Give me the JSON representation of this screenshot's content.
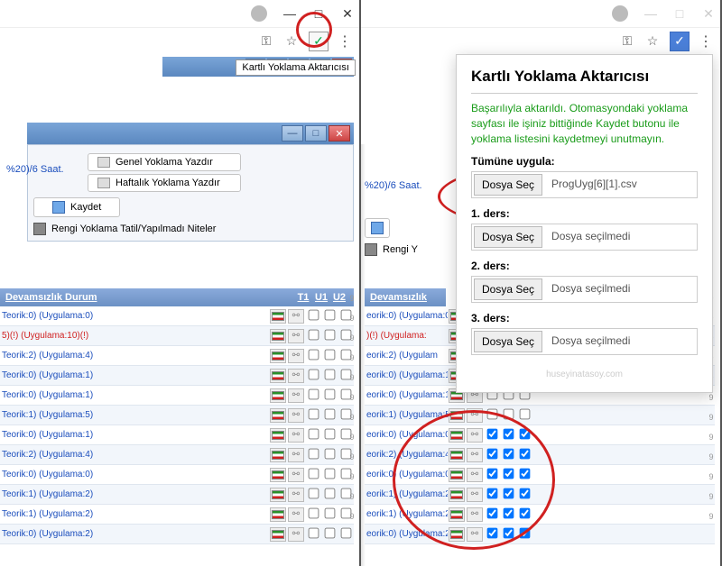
{
  "tooltip": "Kartlı Yoklama Aktarıcısı",
  "popup": {
    "title": "Kartlı Yoklama Aktarıcısı",
    "success": "Başarılıyla aktarıldı. Otomasyondaki yoklama sayfası ile işiniz bittiğinde Kaydet butonu ile yoklama listesini kaydetmeyi unutmayın.",
    "apply_all_label": "Tümüne uygula:",
    "btn_choose": "Dosya Seç",
    "file_all": "ProgUyg[6][1].csv",
    "file_none": "Dosya seçilmedi",
    "ders1": "1. ders:",
    "ders2": "2. ders:",
    "ders3": "3. ders:",
    "credit": "huseyinatasoy.com"
  },
  "panel": {
    "print_genel": "Genel Yoklama Yazdır",
    "print_haftalik": "Haftalık Yoklama Yazdır",
    "teorik_frag": "%20)/6 Saat.",
    "save": "Kaydet",
    "color_label": "Rengi Yoklama Tatil/Yapılmadı Niteler"
  },
  "table": {
    "hdr_durum": "Devamsızlık Durum",
    "hdr_t1": "T1",
    "hdr_u1": "U1",
    "hdr_u2": "U2"
  },
  "rows_left": [
    {
      "t": "Teorik:0)",
      "u": "(Uygulama:0)",
      "r": false
    },
    {
      "t": "5)(!)",
      "u": "(Uygulama:10)(!)",
      "r": true
    },
    {
      "t": "Teorik:2)",
      "u": "(Uygulama:4)",
      "r": false
    },
    {
      "t": "Teorik:0)",
      "u": "(Uygulama:1)",
      "r": false
    },
    {
      "t": "Teorik:0)",
      "u": "(Uygulama:1)",
      "r": false
    },
    {
      "t": "Teorik:1)",
      "u": "(Uygulama:5)",
      "r": false
    },
    {
      "t": "Teorik:0)",
      "u": "(Uygulama:1)",
      "r": false
    },
    {
      "t": "Teorik:2)",
      "u": "(Uygulama:4)",
      "r": false
    },
    {
      "t": "Teorik:0)",
      "u": "(Uygulama:0)",
      "r": false
    },
    {
      "t": "Teorik:1)",
      "u": "(Uygulama:2)",
      "r": false
    },
    {
      "t": "Teorik:1)",
      "u": "(Uygulama:2)",
      "r": false
    },
    {
      "t": "Teorik:0)",
      "u": "(Uygulama:2)",
      "r": false
    }
  ],
  "rows_right": [
    {
      "t": "eorik:0)",
      "u": "(Uygulama:0)",
      "r": false,
      "c": [
        false,
        false,
        false
      ]
    },
    {
      "t": ")(!)",
      "u": "(Uygulama:",
      "r": true,
      "c": [
        false,
        false,
        false
      ]
    },
    {
      "t": "eorik:2)",
      "u": "(Uygulam",
      "r": false,
      "c": [
        false,
        false,
        false
      ]
    },
    {
      "t": "eorik:0)",
      "u": "(Uygulama:1)",
      "r": false,
      "c": [
        false,
        false,
        false
      ]
    },
    {
      "t": "eorik:0)",
      "u": "(Uygulama:1)",
      "r": false,
      "c": [
        false,
        false,
        false
      ]
    },
    {
      "t": "eorik:1)",
      "u": "(Uygulama:5)",
      "r": false,
      "c": [
        false,
        false,
        false
      ]
    },
    {
      "t": "eorik:0)",
      "u": "(Uygulama:0)",
      "r": false,
      "c": [
        true,
        true,
        true
      ]
    },
    {
      "t": "eorik:2)",
      "u": "(Uygulama:4)",
      "r": false,
      "c": [
        true,
        true,
        true
      ]
    },
    {
      "t": "eorik:0)",
      "u": "(Uygulama:0)",
      "r": false,
      "c": [
        true,
        true,
        true
      ]
    },
    {
      "t": "eorik:1)",
      "u": "(Uygulama:2)",
      "r": false,
      "c": [
        true,
        true,
        true
      ]
    },
    {
      "t": "eorik:1)",
      "u": "(Uygulama:2)",
      "r": false,
      "c": [
        true,
        true,
        true
      ]
    },
    {
      "t": "eorik:0)",
      "u": "(Uygulama:2)",
      "r": false,
      "c": [
        true,
        true,
        true
      ]
    }
  ],
  "num_col": [
    "9",
    "9",
    "9",
    "9",
    "9",
    "9",
    "9",
    "9",
    "9",
    "9",
    "9",
    "9"
  ]
}
